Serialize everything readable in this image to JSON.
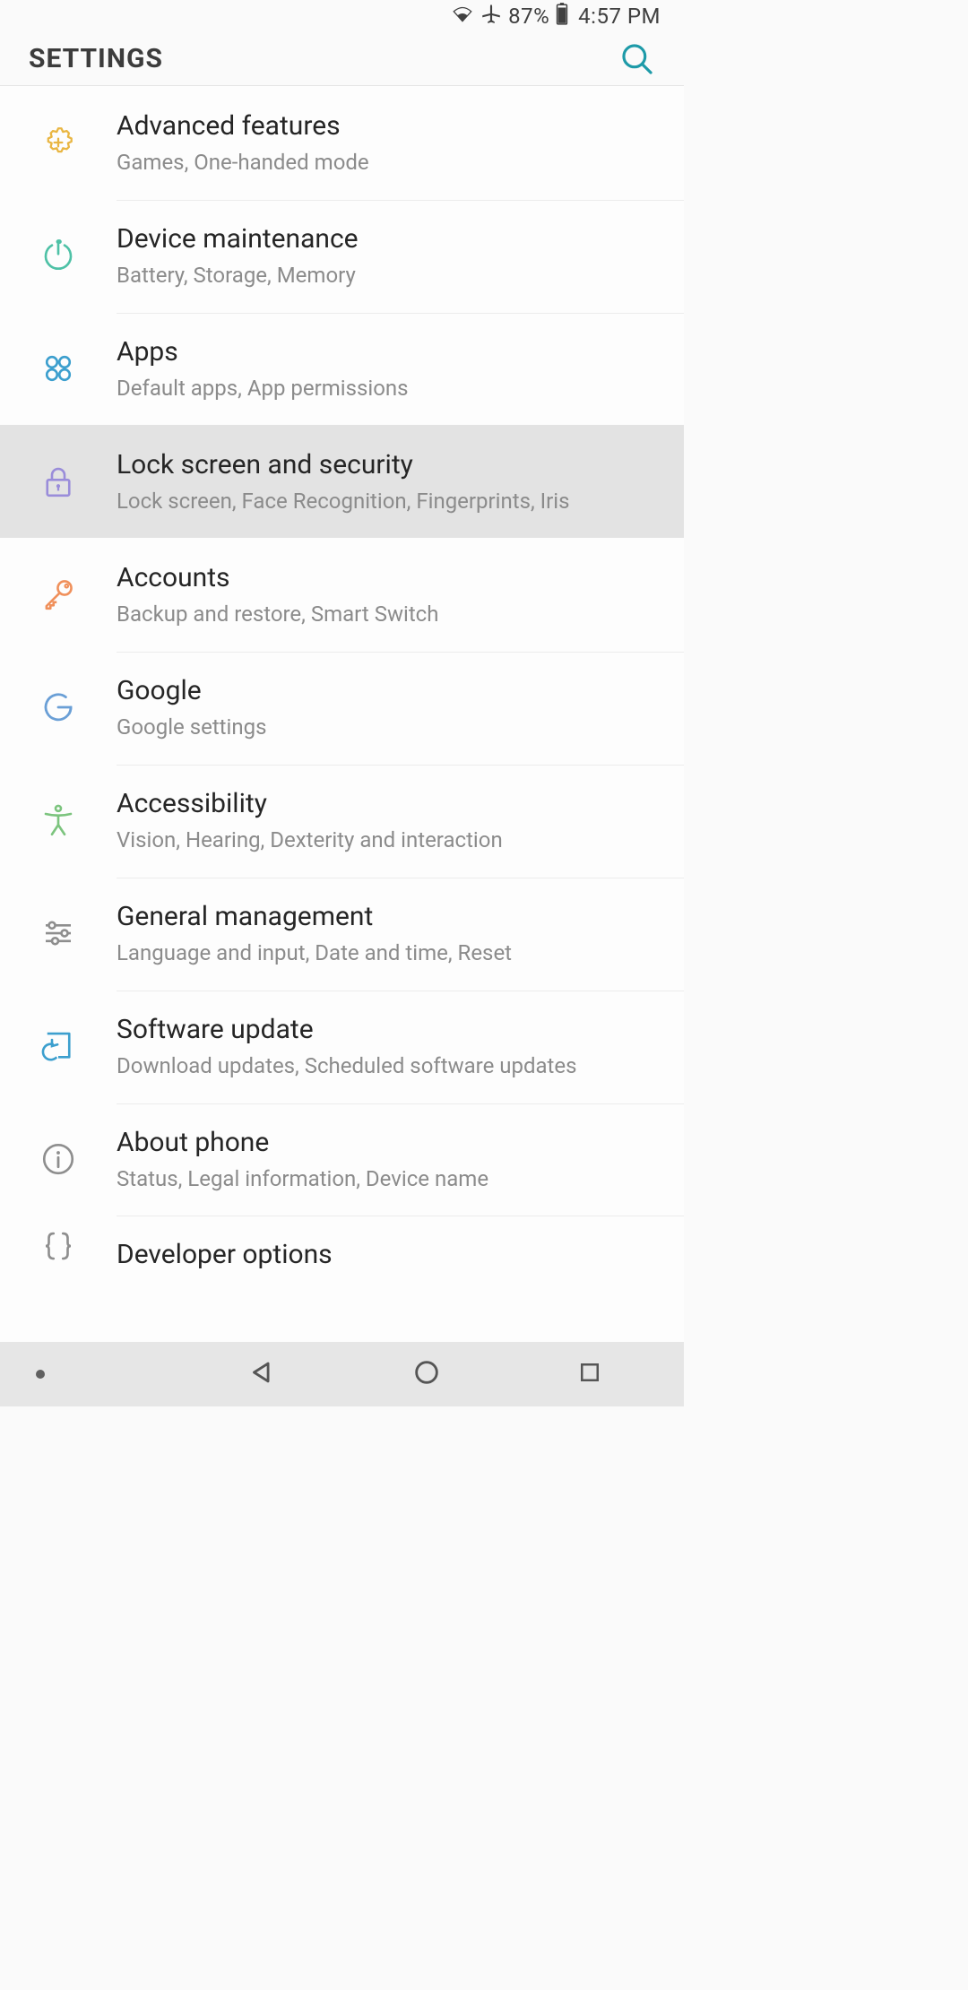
{
  "status": {
    "battery_pct": "87%",
    "time": "4:57 PM"
  },
  "header": {
    "title": "SETTINGS"
  },
  "items": [
    {
      "id": "advanced-features",
      "title": "Advanced features",
      "sub": "Games, One-handed mode"
    },
    {
      "id": "device-maintenance",
      "title": "Device maintenance",
      "sub": "Battery, Storage, Memory"
    },
    {
      "id": "apps",
      "title": "Apps",
      "sub": "Default apps, App permissions"
    },
    {
      "id": "lock-security",
      "title": "Lock screen and security",
      "sub": "Lock screen, Face Recognition, Fingerprints, Iris",
      "highlight": true
    },
    {
      "id": "accounts",
      "title": "Accounts",
      "sub": "Backup and restore, Smart Switch"
    },
    {
      "id": "google",
      "title": "Google",
      "sub": "Google settings"
    },
    {
      "id": "accessibility",
      "title": "Accessibility",
      "sub": "Vision, Hearing, Dexterity and interaction"
    },
    {
      "id": "general-management",
      "title": "General management",
      "sub": "Language and input, Date and time, Reset"
    },
    {
      "id": "software-update",
      "title": "Software update",
      "sub": "Download updates, Scheduled software updates"
    },
    {
      "id": "about-phone",
      "title": "About phone",
      "sub": "Status, Legal information, Device name"
    },
    {
      "id": "developer-options",
      "title": "Developer options",
      "sub": ""
    }
  ]
}
